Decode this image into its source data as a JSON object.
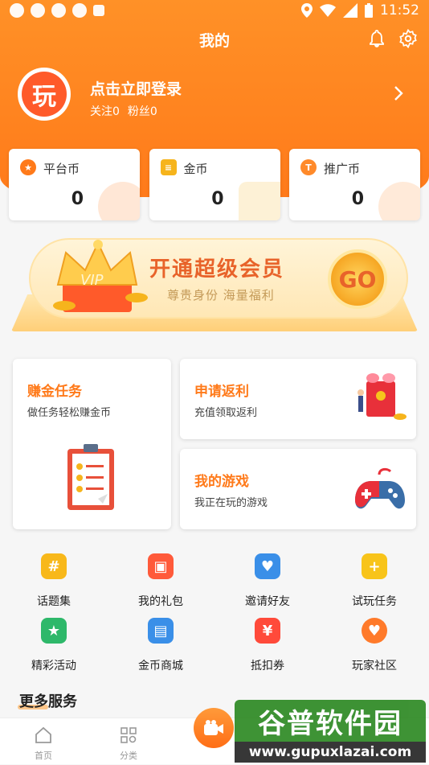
{
  "status": {
    "time": "11:52"
  },
  "header": {
    "title": "我的",
    "avatar_text": "玩",
    "login": "点击立即登录",
    "follow": "关注0",
    "fans": "粉丝0"
  },
  "coins": [
    {
      "label": "平台币",
      "value": "0",
      "color": "#ff7a1a",
      "icon": "star-icon"
    },
    {
      "label": "金币",
      "value": "0",
      "color": "#f6b41c",
      "icon": "coin-stack-icon"
    },
    {
      "label": "推广币",
      "value": "0",
      "color": "#ff8a2a",
      "icon": "t-coin-icon"
    }
  ],
  "vip": {
    "title": "开通超级会员",
    "subtitle": "尊贵身份 海量福利",
    "go": "GO",
    "crown_text": "VIP"
  },
  "tasks": {
    "earn": {
      "title": "赚金任务",
      "subtitle": "做任务轻松赚金币"
    },
    "rebate": {
      "title": "申请返利",
      "subtitle": "充值领取返利"
    },
    "games": {
      "title": "我的游戏",
      "subtitle": "我正在玩的游戏"
    }
  },
  "grid": [
    {
      "label": "话题集",
      "icon": "hash-icon",
      "color": "#f8b81a"
    },
    {
      "label": "我的礼包",
      "icon": "gift-icon",
      "color": "#ff5a3a"
    },
    {
      "label": "邀请好友",
      "icon": "invite-icon",
      "color": "#3a8fe8"
    },
    {
      "label": "试玩任务",
      "icon": "gamepad-icon",
      "color": "#f8c41a"
    },
    {
      "label": "精彩活动",
      "icon": "star-flag-icon",
      "color": "#2eb86a"
    },
    {
      "label": "金币商城",
      "icon": "shop-icon",
      "color": "#3a8fe8"
    },
    {
      "label": "抵扣券",
      "icon": "voucher-icon",
      "color": "#ff4a3a"
    },
    {
      "label": "玩家社区",
      "icon": "chat-icon",
      "color": "#ff7a2a"
    }
  ],
  "more": {
    "title": "更多服务"
  },
  "tabbar": [
    {
      "label": "首页",
      "icon": "home-icon"
    },
    {
      "label": "分类",
      "icon": "category-icon"
    }
  ],
  "watermark": {
    "top": "谷普软件园",
    "bottom": "www.gupuxlazai.com"
  }
}
